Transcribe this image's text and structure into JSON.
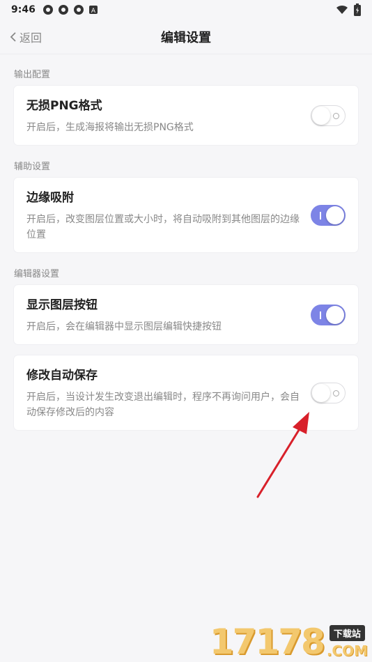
{
  "status_bar": {
    "time": "9:46"
  },
  "header": {
    "back_label": "返回",
    "title": "编辑设置"
  },
  "sections": [
    {
      "label": "输出配置",
      "items": [
        {
          "title": "无损PNG格式",
          "desc": "开启后，生成海报将输出无损PNG格式",
          "enabled": false
        }
      ]
    },
    {
      "label": "辅助设置",
      "items": [
        {
          "title": "边缘吸附",
          "desc": "开启后，改变图层位置或大小时，将自动吸附到其他图层的边缘位置",
          "enabled": true
        }
      ]
    },
    {
      "label": "编辑器设置",
      "items": [
        {
          "title": "显示图层按钮",
          "desc": "开启后，会在编辑器中显示图层编辑快捷按钮",
          "enabled": true
        },
        {
          "title": "修改自动保存",
          "desc": "开启后，当设计发生改变退出编辑时，程序不再询问用户，会自动保存修改后的内容",
          "enabled": false
        }
      ]
    }
  ],
  "watermark": {
    "digits": "17178",
    "tag": "下载站",
    "com": ".COM"
  },
  "colors": {
    "toggle_on": "#7d84e6",
    "arrow": "#d8202a",
    "watermark": "#f3c86e"
  }
}
